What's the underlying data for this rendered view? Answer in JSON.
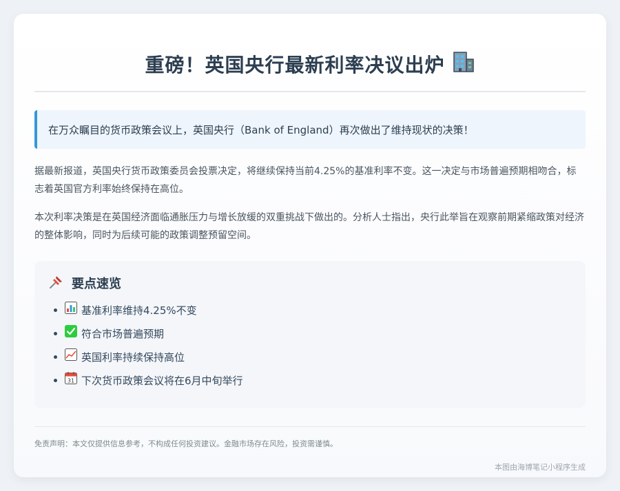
{
  "article": {
    "title": "重磅！英国央行最新利率决议出炉",
    "title_icon": "office-building-icon",
    "callout": "在万众瞩目的货币政策会议上，英国央行（Bank of England）再次做出了维持现状的决策！",
    "paragraphs": [
      "据最新报道，英国央行货币政策委员会投票决定，将继续保持当前4.25%的基准利率不变。这一决定与市场普遍预期相吻合，标志着英国官方利率始终保持在高位。",
      "本次利率决策是在英国经济面临通胀压力与增长放缓的双重挑战下做出的。分析人士指出，央行此举旨在观察前期紧缩政策对经济的整体影响，同时为后续可能的政策调整预留空间。"
    ]
  },
  "key_points": {
    "heading": "要点速览",
    "heading_icon": "pushpin-icon",
    "items": [
      {
        "icon": "bar-chart-icon",
        "text": "基准利率维持4.25%不变"
      },
      {
        "icon": "check-mark-icon",
        "text": "符合市场普遍预期"
      },
      {
        "icon": "trending-up-icon",
        "text": "英国利率持续保持高位"
      },
      {
        "icon": "calendar-icon",
        "text": "下次货币政策会议将在6月中旬举行"
      }
    ]
  },
  "footer": {
    "disclaimer": "免责声明：本文仅提供信息参考，不构成任何投资建议。金融市场存在风险，投资需谨慎。",
    "credit": "本图由海博笔记小程序生成"
  },
  "colors": {
    "accent": "#3498db",
    "title": "#2c3e50",
    "check_green": "#2ecc40"
  }
}
